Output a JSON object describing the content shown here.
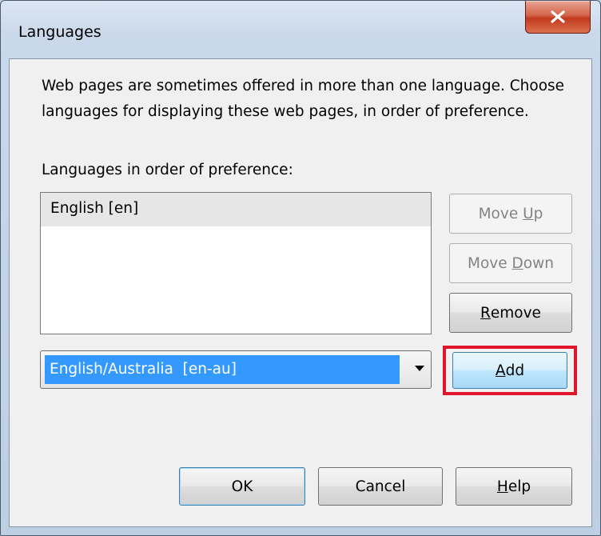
{
  "window": {
    "title": "Languages",
    "close_icon": "close-x-icon"
  },
  "description": "Web pages are sometimes offered in more than one language. Choose languages for displaying these web pages, in order of preference.",
  "list": {
    "label": "Languages in order of preference:",
    "items": [
      "English  [en]"
    ]
  },
  "buttons": {
    "move_up": {
      "pre": "Move ",
      "key": "U",
      "post": "p"
    },
    "move_down": {
      "pre": "Move ",
      "key": "D",
      "post": "own"
    },
    "remove": {
      "pre": "",
      "key": "R",
      "post": "emove"
    },
    "add": {
      "pre": "",
      "key": "A",
      "post": "dd"
    },
    "ok": "OK",
    "cancel": "Cancel",
    "help": {
      "pre": "",
      "key": "H",
      "post": "elp"
    }
  },
  "language_select": {
    "selected": "English/Australia  [en-au]"
  },
  "colors": {
    "highlight_outline": "#e0142a",
    "selection": "#3399ff"
  }
}
